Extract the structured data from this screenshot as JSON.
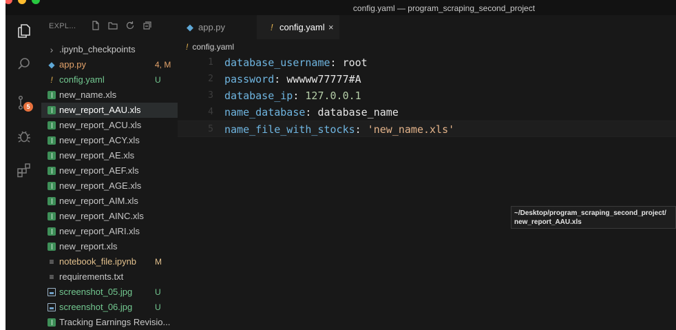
{
  "window": {
    "title": "config.yaml — program_scraping_second_project"
  },
  "activity_bar": {
    "scm_badge": "5"
  },
  "explorer": {
    "title": "EXPL...",
    "items": [
      {
        "name": ".ipynb_checkpoints",
        "type": "folder",
        "status": "",
        "color": "#c8c8c8",
        "status_color": ""
      },
      {
        "name": "app.py",
        "type": "python",
        "status": "4, M",
        "color": "#e2a26a",
        "status_color": "#e2a26a"
      },
      {
        "name": "config.yaml",
        "type": "yaml",
        "status": "U",
        "color": "#73c991",
        "status_color": "#73c991"
      },
      {
        "name": "new_name.xls",
        "type": "xls",
        "status": "",
        "color": "#c8c8c8",
        "status_color": ""
      },
      {
        "name": "new_report_AAU.xls",
        "type": "xls",
        "status": "",
        "color": "#ffffff",
        "status_color": ""
      },
      {
        "name": "new_report_ACU.xls",
        "type": "xls",
        "status": "",
        "color": "#c8c8c8",
        "status_color": ""
      },
      {
        "name": "new_report_ACY.xls",
        "type": "xls",
        "status": "",
        "color": "#c8c8c8",
        "status_color": ""
      },
      {
        "name": "new_report_AE.xls",
        "type": "xls",
        "status": "",
        "color": "#c8c8c8",
        "status_color": ""
      },
      {
        "name": "new_report_AEF.xls",
        "type": "xls",
        "status": "",
        "color": "#c8c8c8",
        "status_color": ""
      },
      {
        "name": "new_report_AGE.xls",
        "type": "xls",
        "status": "",
        "color": "#c8c8c8",
        "status_color": ""
      },
      {
        "name": "new_report_AIM.xls",
        "type": "xls",
        "status": "",
        "color": "#c8c8c8",
        "status_color": ""
      },
      {
        "name": "new_report_AINC.xls",
        "type": "xls",
        "status": "",
        "color": "#c8c8c8",
        "status_color": ""
      },
      {
        "name": "new_report_AIRI.xls",
        "type": "xls",
        "status": "",
        "color": "#c8c8c8",
        "status_color": ""
      },
      {
        "name": "new_report.xls",
        "type": "xls",
        "status": "",
        "color": "#c8c8c8",
        "status_color": ""
      },
      {
        "name": "notebook_file.ipynb",
        "type": "text",
        "status": "M",
        "color": "#e2c08d",
        "status_color": "#e2c08d"
      },
      {
        "name": "requirements.txt",
        "type": "text",
        "status": "",
        "color": "#c8c8c8",
        "status_color": ""
      },
      {
        "name": "screenshot_05.jpg",
        "type": "image",
        "status": "U",
        "color": "#73c991",
        "status_color": "#73c991"
      },
      {
        "name": "screenshot_06.jpg",
        "type": "image",
        "status": "U",
        "color": "#73c991",
        "status_color": "#73c991"
      },
      {
        "name": "Tracking Earnings Revisio...",
        "type": "xls",
        "status": "",
        "color": "#c8c8c8",
        "status_color": ""
      }
    ]
  },
  "tabs": [
    {
      "label": "app.py",
      "active": false
    },
    {
      "label": "config.yaml",
      "active": true
    }
  ],
  "breadcrumb": "config.yaml",
  "code_lines": [
    {
      "num": "1",
      "key": "database_username",
      "value": "root",
      "vtype": "plain"
    },
    {
      "num": "2",
      "key": "password",
      "value": "wwwww77777#A",
      "vtype": "plain"
    },
    {
      "num": "3",
      "key": "database_ip",
      "value": "127.0.0.1",
      "vtype": "number"
    },
    {
      "num": "4",
      "key": "name_database",
      "value": "database_name",
      "vtype": "plain"
    },
    {
      "num": "5",
      "key": "name_file_with_stocks",
      "value": "'new_name.xls'",
      "vtype": "string"
    }
  ],
  "tooltip": {
    "line1": "~/Desktop/program_scraping_second_project/",
    "line2": "new_report_AAU.xls"
  }
}
